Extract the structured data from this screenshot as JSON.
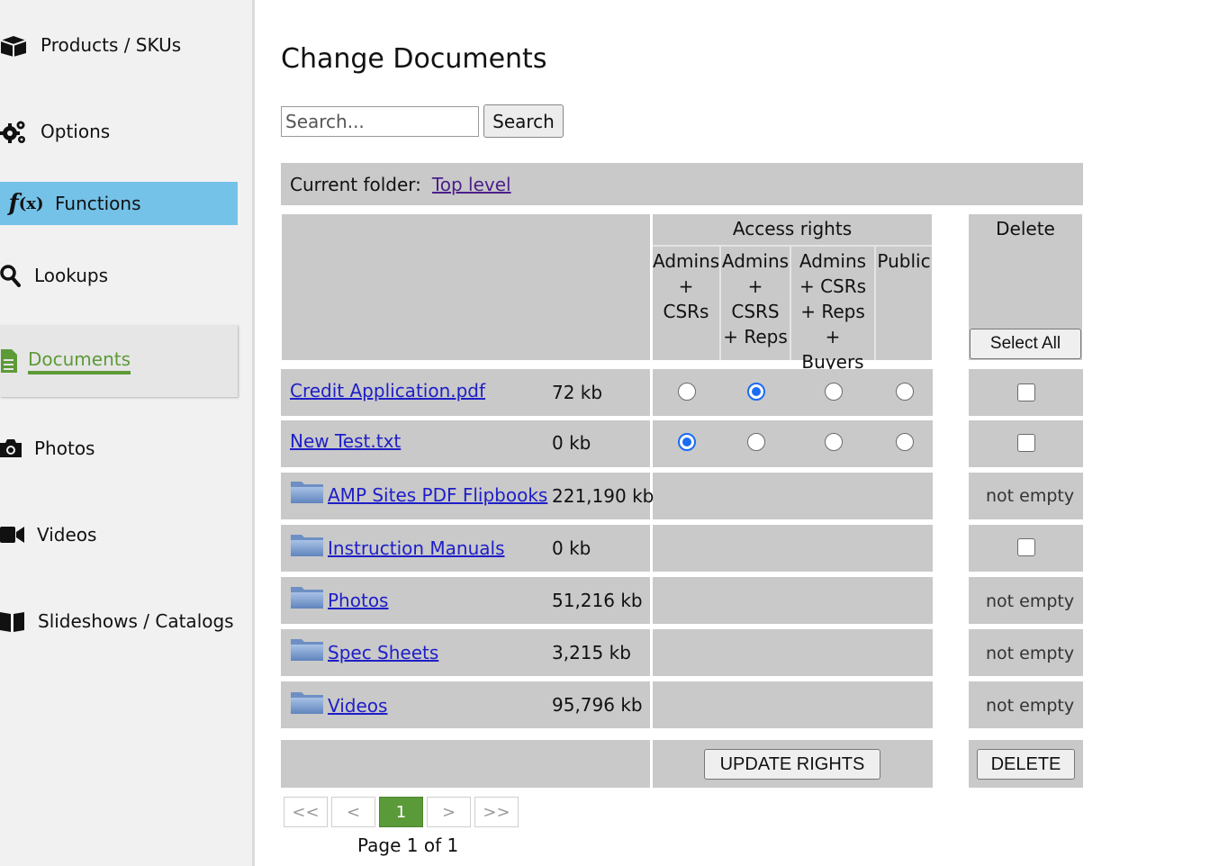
{
  "sidebar": {
    "items": [
      {
        "label": "Products / SKUs",
        "icon": "box-icon"
      },
      {
        "label": "Options",
        "icon": "gears-icon"
      },
      {
        "label": "Functions",
        "icon": "function-icon"
      },
      {
        "label": "Lookups",
        "icon": "search-icon"
      },
      {
        "label": "Documents",
        "icon": "document-icon"
      },
      {
        "label": "Photos",
        "icon": "camera-icon"
      },
      {
        "label": "Videos",
        "icon": "video-icon"
      },
      {
        "label": "Slideshows / Catalogs",
        "icon": "book-icon"
      }
    ],
    "active_colors": {
      "functions_bg": "#74c2e8",
      "documents_text": "#5d9a38"
    }
  },
  "main": {
    "title": "Change Documents",
    "search": {
      "placeholder": "Search...",
      "value": "",
      "button_label": "Search"
    },
    "current_folder": {
      "label": "Current folder:",
      "link": "Top level"
    },
    "table": {
      "access_header": "Access rights",
      "access_columns": [
        [
          "Admins",
          "+ CSRs"
        ],
        [
          "Admins",
          "+ CSRS",
          "+ Reps"
        ],
        [
          "Admins",
          "+ CSRs",
          "+ Reps",
          "+ Buyers"
        ],
        [
          "Public"
        ]
      ],
      "delete_header": "Delete",
      "select_all_label": "Select All",
      "files": [
        {
          "name": "Credit Application.pdf",
          "size": "72 kb",
          "access": 1,
          "delete": "checkbox"
        },
        {
          "name": "New Test.txt",
          "size": "0 kb",
          "access": 0,
          "delete": "checkbox"
        }
      ],
      "folders": [
        {
          "name": "AMP Sites PDF Flipbooks",
          "size": "221,190 kb",
          "delete": "not empty"
        },
        {
          "name": "Instruction Manuals",
          "size": "0 kb",
          "delete": "checkbox"
        },
        {
          "name": "Photos",
          "size": "51,216 kb",
          "delete": "not empty"
        },
        {
          "name": "Spec Sheets",
          "size": "3,215 kb",
          "delete": "not empty"
        },
        {
          "name": "Videos",
          "size": "95,796 kb",
          "delete": "not empty"
        }
      ],
      "update_rights_label": "UPDATE RIGHTS",
      "delete_label": "DELETE"
    },
    "pager": {
      "first": "<<",
      "prev": "<",
      "current": "1",
      "next": ">",
      "last": ">>",
      "info": "Page 1 of 1"
    }
  }
}
